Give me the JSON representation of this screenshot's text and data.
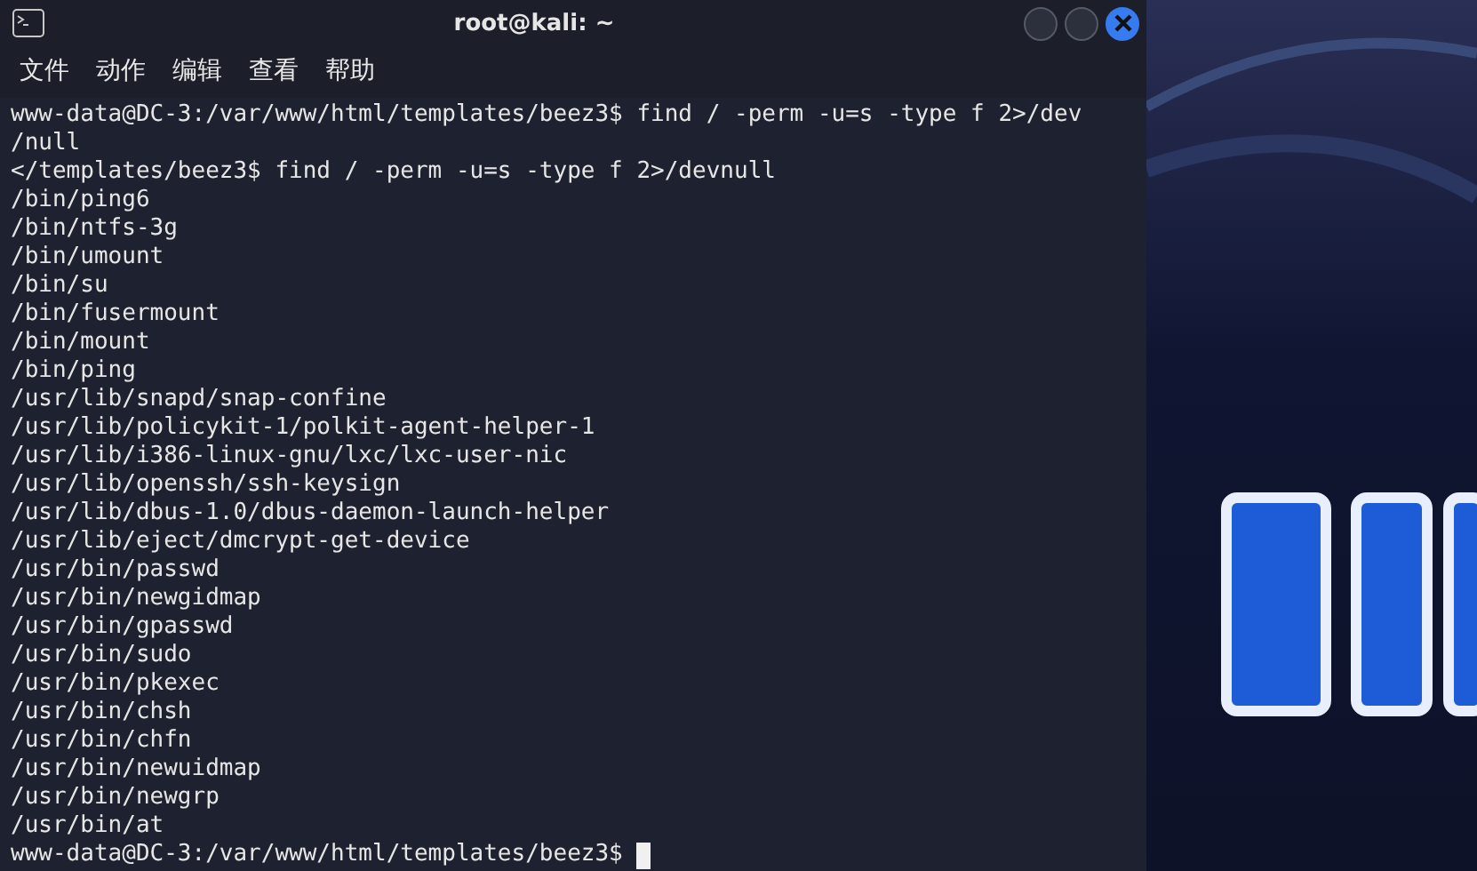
{
  "window": {
    "title": "root@kali: ~"
  },
  "menu": [
    "文件",
    "动作",
    "编辑",
    "查看",
    "帮助"
  ],
  "terminal": {
    "lines": [
      "www-data@DC-3:/var/www/html/templates/beez3$ find / -perm -u=s -type f 2>/dev",
      "/null",
      "</templates/beez3$ find / -perm -u=s -type f 2>/devnull",
      "/bin/ping6",
      "/bin/ntfs-3g",
      "/bin/umount",
      "/bin/su",
      "/bin/fusermount",
      "/bin/mount",
      "/bin/ping",
      "/usr/lib/snapd/snap-confine",
      "/usr/lib/policykit-1/polkit-agent-helper-1",
      "/usr/lib/i386-linux-gnu/lxc/lxc-user-nic",
      "/usr/lib/openssh/ssh-keysign",
      "/usr/lib/dbus-1.0/dbus-daemon-launch-helper",
      "/usr/lib/eject/dmcrypt-get-device",
      "/usr/bin/passwd",
      "/usr/bin/newgidmap",
      "/usr/bin/gpasswd",
      "/usr/bin/sudo",
      "/usr/bin/pkexec",
      "/usr/bin/chsh",
      "/usr/bin/chfn",
      "/usr/bin/newuidmap",
      "/usr/bin/newgrp",
      "/usr/bin/at"
    ],
    "prompt": "www-data@DC-3:/var/www/html/templates/beez3$"
  }
}
